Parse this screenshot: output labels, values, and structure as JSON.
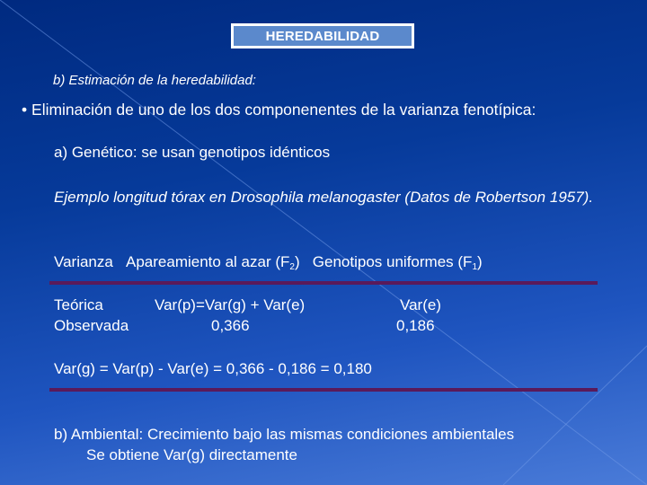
{
  "title": "HEREDABILIDAD",
  "subtitle": "b) Estimación de la heredabilidad:",
  "bullet": {
    "marker": "•",
    "text": "Eliminación de uno de los dos componenentes de la varianza fenotípica:"
  },
  "genetic": "a) Genético: se usan genotipos idénticos",
  "example": "Ejemplo longitud tórax en Drosophila melanogaster (Datos de Robertson 1957).",
  "table": {
    "header": {
      "col0": "Varianza",
      "col1_text": "Apareamiento al azar (F",
      "col1_sub": "2",
      "col1_close": ")",
      "col2_text": "Genotipos uniformes (F",
      "col2_sub": "1",
      "col2_close": ")"
    },
    "rows": [
      {
        "label": "Teórica",
        "f2": "Var(p)=Var(g) + Var(e)",
        "f1": "Var(e)"
      },
      {
        "label": "Observada",
        "f2": "0,366",
        "f1": "0,186"
      }
    ]
  },
  "calculation": "Var(g) = Var(p) - Var(e) = 0,366 - 0,186 = 0,180",
  "environmental": {
    "line1": "b) Ambiental: Crecimiento bajo las mismas condiciones ambientales",
    "line2": "Se obtiene Var(g) directamente"
  },
  "colors": {
    "background_top": "#002a80",
    "background_bottom": "#4a7bd8",
    "title_box": "#5b89cc",
    "rule": "#5a1a5a",
    "text": "#ffffff"
  }
}
